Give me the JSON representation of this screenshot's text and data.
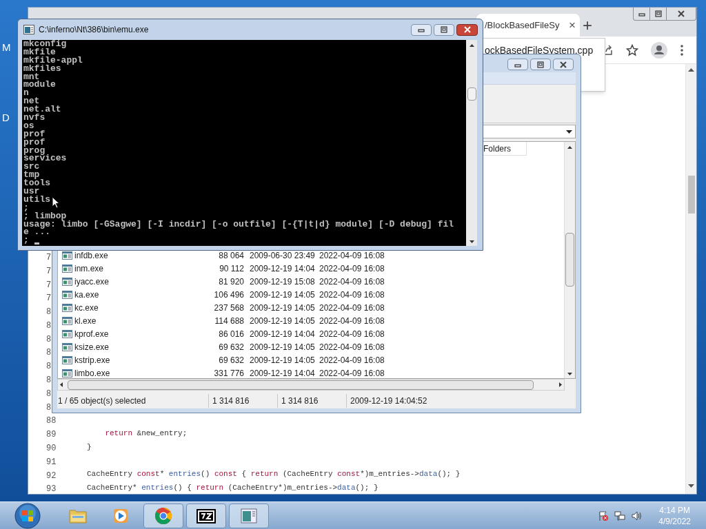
{
  "desktop": {
    "icon_labels": [
      "M",
      "D"
    ]
  },
  "browser": {
    "tab": {
      "title": "/BlockBasedFileSy",
      "close": "×"
    },
    "new_tab": "+",
    "address_popup": "ockBasedFileSystem.cpp",
    "code_lines": [
      {
        "number": "7"
      },
      {
        "number": "7"
      },
      {
        "number": "7"
      },
      {
        "number": "7"
      },
      {
        "number": "8"
      },
      {
        "number": "8"
      },
      {
        "number": "8"
      },
      {
        "number": "8"
      },
      {
        "number": "8"
      },
      {
        "number": "8"
      },
      {
        "number": "8"
      },
      {
        "number": "8"
      },
      {
        "number": "88"
      },
      {
        "number": "89",
        "tokens": [
          {
            "text": "    return",
            "kind": "keyword"
          },
          {
            "text": " &new_entry;",
            "kind": "plain"
          }
        ]
      },
      {
        "number": "90",
        "tokens": [
          {
            "text": "}",
            "kind": "plain"
          }
        ]
      },
      {
        "number": "91"
      },
      {
        "number": "92",
        "tokens": [
          {
            "text": "CacheEntry ",
            "kind": "plain"
          },
          {
            "text": "const",
            "kind": "keyword"
          },
          {
            "text": "* ",
            "kind": "plain"
          },
          {
            "text": "entries",
            "kind": "func"
          },
          {
            "text": "() ",
            "kind": "plain"
          },
          {
            "text": "const",
            "kind": "keyword"
          },
          {
            "text": " { ",
            "kind": "plain"
          },
          {
            "text": "return",
            "kind": "keyword"
          },
          {
            "text": " (CacheEntry ",
            "kind": "plain"
          },
          {
            "text": "const",
            "kind": "keyword"
          },
          {
            "text": "*)m_entries->",
            "kind": "plain"
          },
          {
            "text": "data",
            "kind": "func"
          },
          {
            "text": "(); }",
            "kind": "plain"
          }
        ]
      },
      {
        "number": "93",
        "tokens": [
          {
            "text": "CacheEntry* ",
            "kind": "plain"
          },
          {
            "text": "entries",
            "kind": "func"
          },
          {
            "text": "() { ",
            "kind": "plain"
          },
          {
            "text": "return",
            "kind": "keyword"
          },
          {
            "text": " (CacheEntry*)m_entries->",
            "kind": "plain"
          },
          {
            "text": "data",
            "kind": "func"
          },
          {
            "text": "(); }",
            "kind": "plain"
          }
        ]
      }
    ]
  },
  "file_manager": {
    "folders_header": "Folders",
    "files": [
      {
        "name": "infdb.exe",
        "column_2": "88 064",
        "column_3": "2009-06-30 23:49",
        "column_4": "2022-04-09 16:08"
      },
      {
        "name": "inm.exe",
        "column_2": "90 112",
        "column_3": "2009-12-19 14:04",
        "column_4": "2022-04-09 16:08"
      },
      {
        "name": "iyacc.exe",
        "column_2": "81 920",
        "column_3": "2009-12-19 15:08",
        "column_4": "2022-04-09 16:08"
      },
      {
        "name": "ka.exe",
        "column_2": "106 496",
        "column_3": "2009-12-19 14:05",
        "column_4": "2022-04-09 16:08"
      },
      {
        "name": "kc.exe",
        "column_2": "237 568",
        "column_3": "2009-12-19 14:05",
        "column_4": "2022-04-09 16:08"
      },
      {
        "name": "kl.exe",
        "column_2": "114 688",
        "column_3": "2009-12-19 14:05",
        "column_4": "2022-04-09 16:08"
      },
      {
        "name": "kprof.exe",
        "column_2": "86 016",
        "column_3": "2009-12-19 14:04",
        "column_4": "2022-04-09 16:08"
      },
      {
        "name": "ksize.exe",
        "column_2": "69 632",
        "column_3": "2009-12-19 14:05",
        "column_4": "2022-04-09 16:08"
      },
      {
        "name": "kstrip.exe",
        "column_2": "69 632",
        "column_3": "2009-12-19 14:05",
        "column_4": "2022-04-09 16:08"
      },
      {
        "name": "limbo.exe",
        "column_2": "331 776",
        "column_3": "2009-12-19 14:04",
        "column_4": "2022-04-09 16:08"
      }
    ],
    "status_bar": [
      "1 / 65 object(s) selected",
      "1 314 816",
      "1 314 816",
      "2009-12-19 14:04:52"
    ]
  },
  "terminal": {
    "title": "C:\\inferno\\Nt\\386\\bin\\emu.exe",
    "lines": [
      "mkconfig",
      "mkfile",
      "mkfile-appl",
      "mkfiles",
      "mnt",
      "module",
      "n",
      "net",
      "net.alt",
      "nvfs",
      "os",
      "prof",
      "prof",
      "prog",
      "services",
      "src",
      "tmp",
      "tools",
      "usr",
      "utils",
      ";",
      "; limbop",
      "usage: limbo [-GSagwe] [-I incdir] [-o outfile] [-{T|t|d} module] [-D debug] fil",
      "e ..."
    ],
    "prompt": ";"
  },
  "taskbar": {
    "apps": [
      {
        "kind": "folder",
        "running": false
      },
      {
        "kind": "media",
        "running": false
      },
      {
        "kind": "chrome",
        "running": true
      },
      {
        "kind": "sevenzip",
        "running": true
      },
      {
        "kind": "console",
        "running": true
      }
    ],
    "clock": {
      "time": "4:14 PM",
      "date": "4/9/2022"
    }
  }
}
